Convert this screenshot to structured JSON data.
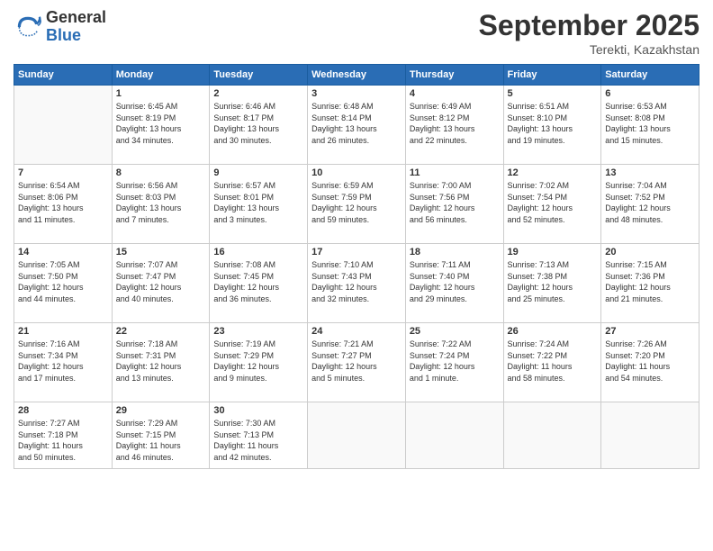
{
  "logo": {
    "general": "General",
    "blue": "Blue"
  },
  "title": {
    "month": "September 2025",
    "location": "Terekti, Kazakhstan"
  },
  "days_header": [
    "Sunday",
    "Monday",
    "Tuesday",
    "Wednesday",
    "Thursday",
    "Friday",
    "Saturday"
  ],
  "weeks": [
    [
      {
        "day": "",
        "info": ""
      },
      {
        "day": "1",
        "info": "Sunrise: 6:45 AM\nSunset: 8:19 PM\nDaylight: 13 hours\nand 34 minutes."
      },
      {
        "day": "2",
        "info": "Sunrise: 6:46 AM\nSunset: 8:17 PM\nDaylight: 13 hours\nand 30 minutes."
      },
      {
        "day": "3",
        "info": "Sunrise: 6:48 AM\nSunset: 8:14 PM\nDaylight: 13 hours\nand 26 minutes."
      },
      {
        "day": "4",
        "info": "Sunrise: 6:49 AM\nSunset: 8:12 PM\nDaylight: 13 hours\nand 22 minutes."
      },
      {
        "day": "5",
        "info": "Sunrise: 6:51 AM\nSunset: 8:10 PM\nDaylight: 13 hours\nand 19 minutes."
      },
      {
        "day": "6",
        "info": "Sunrise: 6:53 AM\nSunset: 8:08 PM\nDaylight: 13 hours\nand 15 minutes."
      }
    ],
    [
      {
        "day": "7",
        "info": "Sunrise: 6:54 AM\nSunset: 8:06 PM\nDaylight: 13 hours\nand 11 minutes."
      },
      {
        "day": "8",
        "info": "Sunrise: 6:56 AM\nSunset: 8:03 PM\nDaylight: 13 hours\nand 7 minutes."
      },
      {
        "day": "9",
        "info": "Sunrise: 6:57 AM\nSunset: 8:01 PM\nDaylight: 13 hours\nand 3 minutes."
      },
      {
        "day": "10",
        "info": "Sunrise: 6:59 AM\nSunset: 7:59 PM\nDaylight: 12 hours\nand 59 minutes."
      },
      {
        "day": "11",
        "info": "Sunrise: 7:00 AM\nSunset: 7:56 PM\nDaylight: 12 hours\nand 56 minutes."
      },
      {
        "day": "12",
        "info": "Sunrise: 7:02 AM\nSunset: 7:54 PM\nDaylight: 12 hours\nand 52 minutes."
      },
      {
        "day": "13",
        "info": "Sunrise: 7:04 AM\nSunset: 7:52 PM\nDaylight: 12 hours\nand 48 minutes."
      }
    ],
    [
      {
        "day": "14",
        "info": "Sunrise: 7:05 AM\nSunset: 7:50 PM\nDaylight: 12 hours\nand 44 minutes."
      },
      {
        "day": "15",
        "info": "Sunrise: 7:07 AM\nSunset: 7:47 PM\nDaylight: 12 hours\nand 40 minutes."
      },
      {
        "day": "16",
        "info": "Sunrise: 7:08 AM\nSunset: 7:45 PM\nDaylight: 12 hours\nand 36 minutes."
      },
      {
        "day": "17",
        "info": "Sunrise: 7:10 AM\nSunset: 7:43 PM\nDaylight: 12 hours\nand 32 minutes."
      },
      {
        "day": "18",
        "info": "Sunrise: 7:11 AM\nSunset: 7:40 PM\nDaylight: 12 hours\nand 29 minutes."
      },
      {
        "day": "19",
        "info": "Sunrise: 7:13 AM\nSunset: 7:38 PM\nDaylight: 12 hours\nand 25 minutes."
      },
      {
        "day": "20",
        "info": "Sunrise: 7:15 AM\nSunset: 7:36 PM\nDaylight: 12 hours\nand 21 minutes."
      }
    ],
    [
      {
        "day": "21",
        "info": "Sunrise: 7:16 AM\nSunset: 7:34 PM\nDaylight: 12 hours\nand 17 minutes."
      },
      {
        "day": "22",
        "info": "Sunrise: 7:18 AM\nSunset: 7:31 PM\nDaylight: 12 hours\nand 13 minutes."
      },
      {
        "day": "23",
        "info": "Sunrise: 7:19 AM\nSunset: 7:29 PM\nDaylight: 12 hours\nand 9 minutes."
      },
      {
        "day": "24",
        "info": "Sunrise: 7:21 AM\nSunset: 7:27 PM\nDaylight: 12 hours\nand 5 minutes."
      },
      {
        "day": "25",
        "info": "Sunrise: 7:22 AM\nSunset: 7:24 PM\nDaylight: 12 hours\nand 1 minute."
      },
      {
        "day": "26",
        "info": "Sunrise: 7:24 AM\nSunset: 7:22 PM\nDaylight: 11 hours\nand 58 minutes."
      },
      {
        "day": "27",
        "info": "Sunrise: 7:26 AM\nSunset: 7:20 PM\nDaylight: 11 hours\nand 54 minutes."
      }
    ],
    [
      {
        "day": "28",
        "info": "Sunrise: 7:27 AM\nSunset: 7:18 PM\nDaylight: 11 hours\nand 50 minutes."
      },
      {
        "day": "29",
        "info": "Sunrise: 7:29 AM\nSunset: 7:15 PM\nDaylight: 11 hours\nand 46 minutes."
      },
      {
        "day": "30",
        "info": "Sunrise: 7:30 AM\nSunset: 7:13 PM\nDaylight: 11 hours\nand 42 minutes."
      },
      {
        "day": "",
        "info": ""
      },
      {
        "day": "",
        "info": ""
      },
      {
        "day": "",
        "info": ""
      },
      {
        "day": "",
        "info": ""
      }
    ]
  ]
}
